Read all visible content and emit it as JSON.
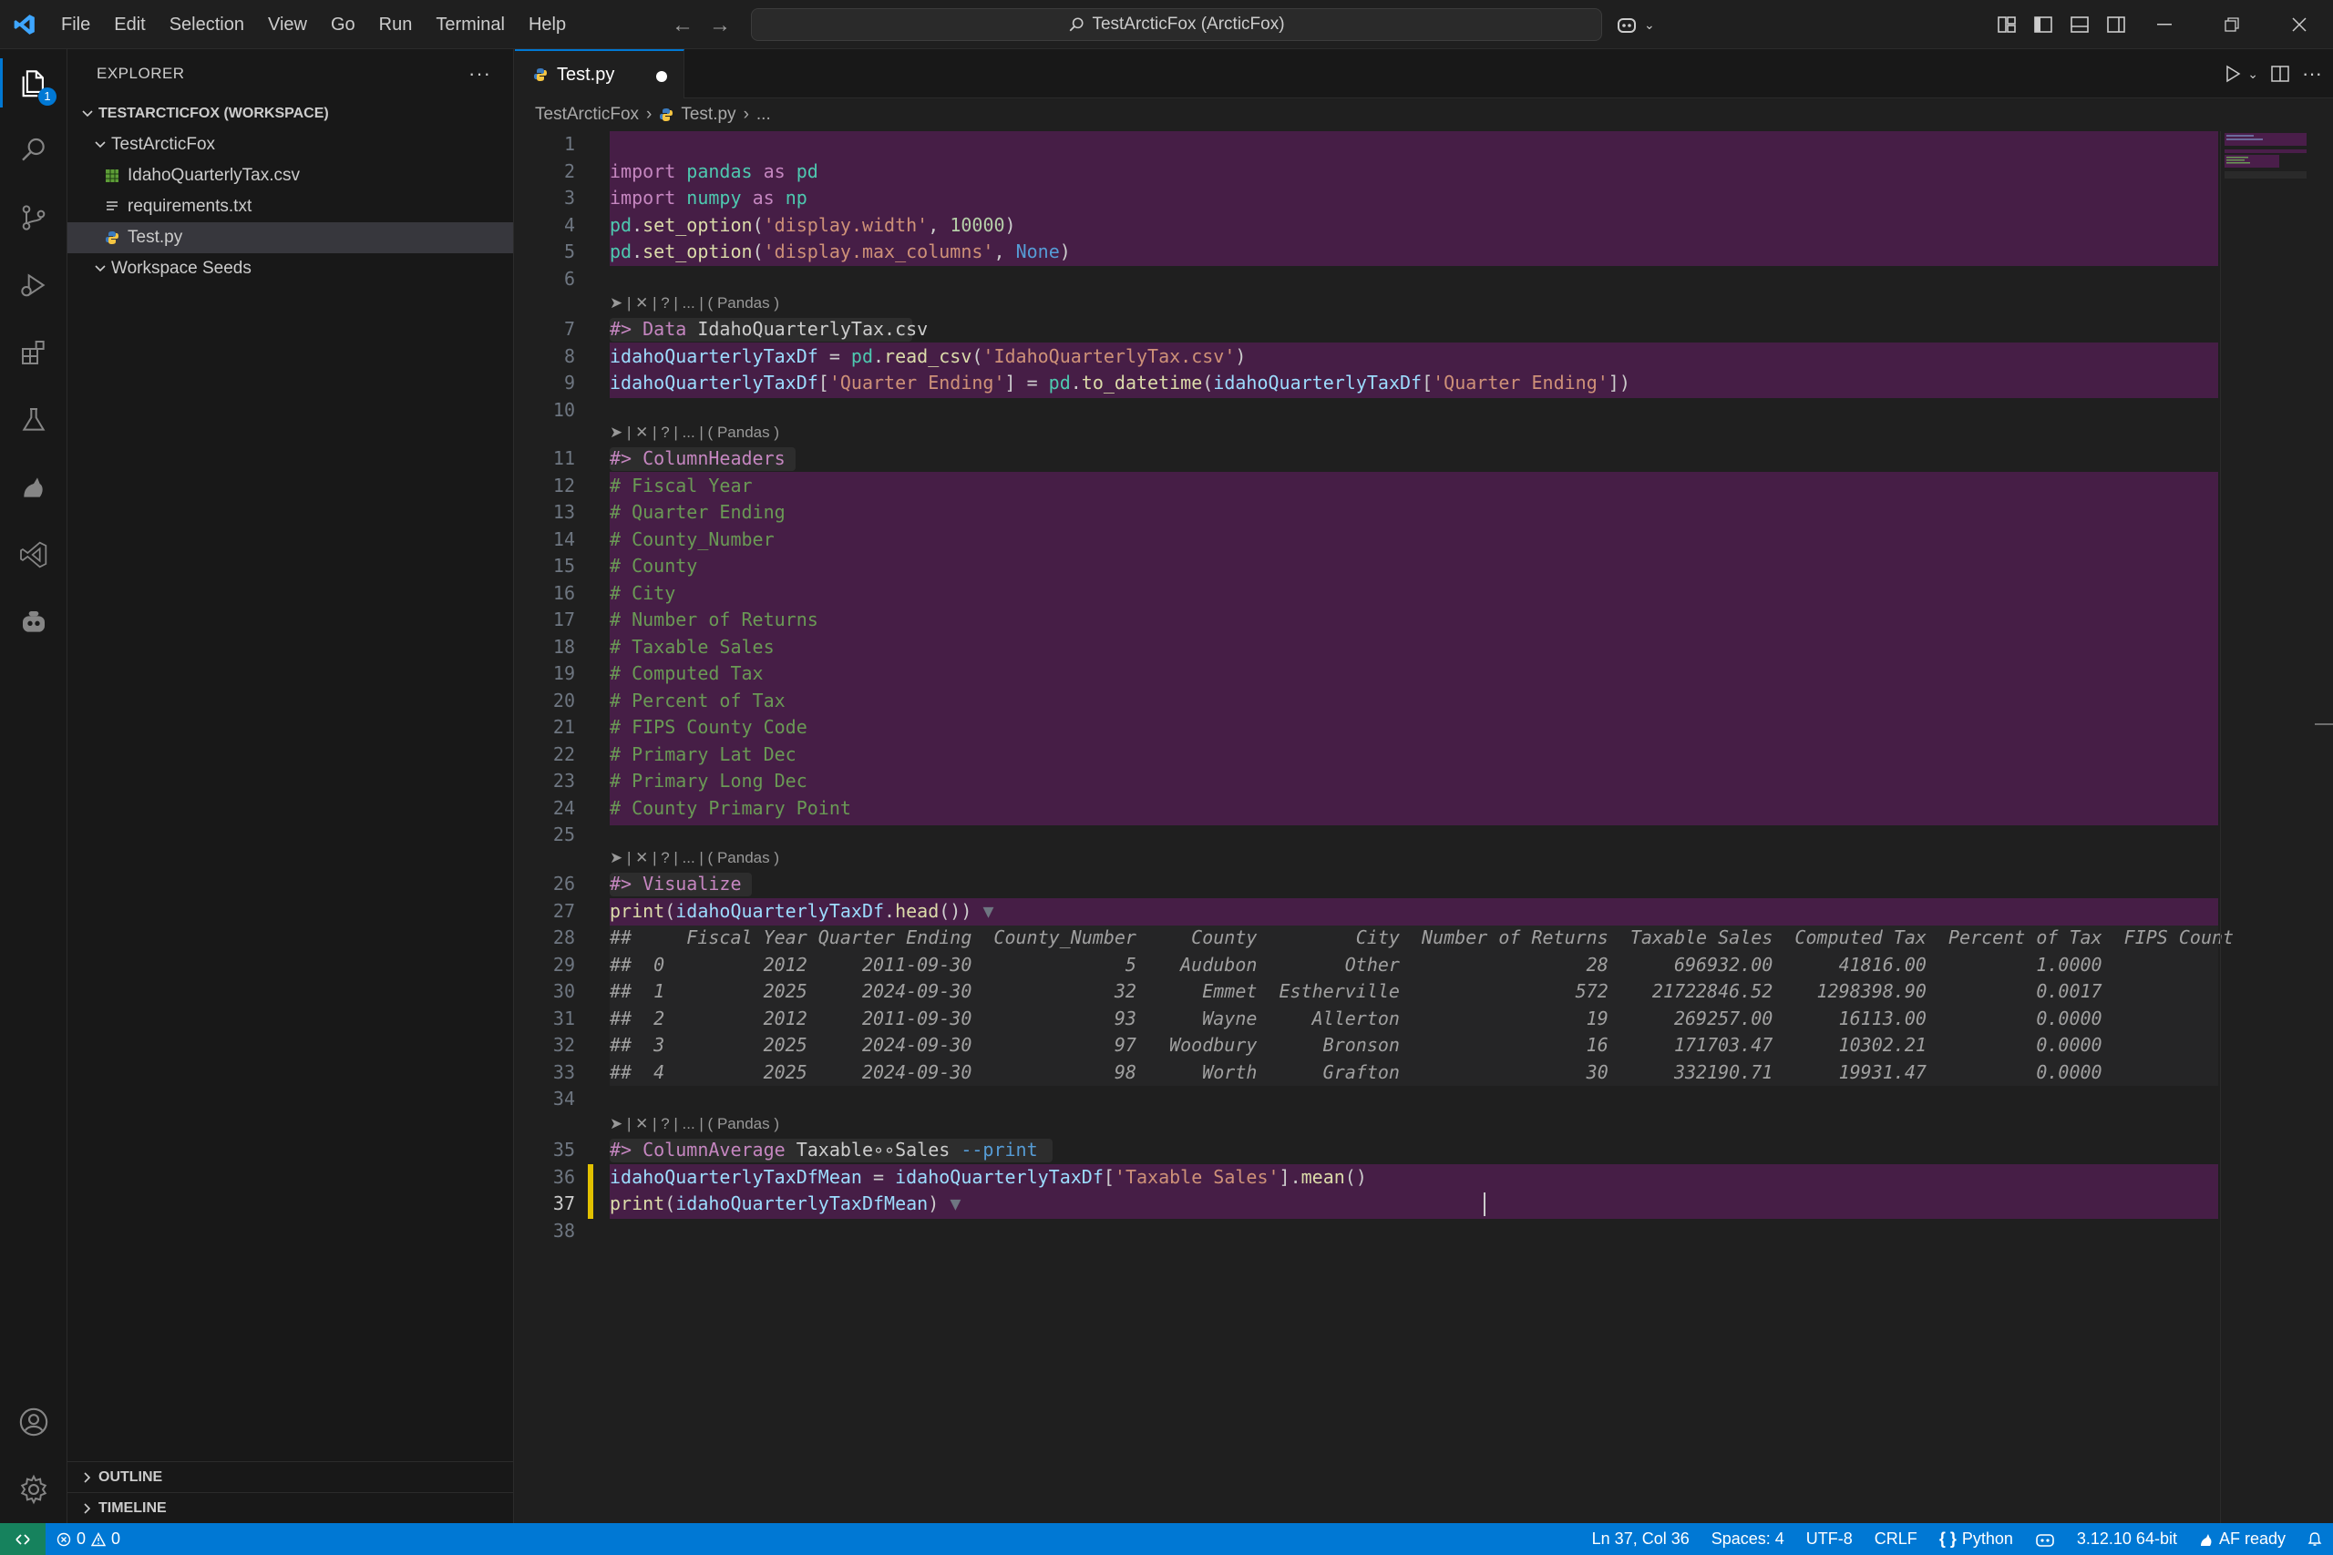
{
  "titlebar": {
    "menu": [
      "File",
      "Edit",
      "Selection",
      "View",
      "Go",
      "Run",
      "Terminal",
      "Help"
    ],
    "search_text": "TestArcticFox (ArcticFox)"
  },
  "activity": {
    "explorer_badge": "1"
  },
  "sidebar": {
    "title": "EXPLORER",
    "workspace": "TESTARCTICFOX (WORKSPACE)",
    "folder": "TestArcticFox",
    "files": [
      "IdahoQuarterlyTax.csv",
      "requirements.txt",
      "Test.py"
    ],
    "folder2": "Workspace Seeds",
    "outline": "OUTLINE",
    "timeline": "TIMELINE"
  },
  "tab": {
    "label": "Test.py"
  },
  "breadcrumb": {
    "root": "TestArcticFox",
    "file": "Test.py",
    "more": "..."
  },
  "editor": {
    "line_numbers": [
      "1",
      "2",
      "3",
      "4",
      "5",
      "6",
      "7",
      "8",
      "9",
      "10",
      "11",
      "12",
      "13",
      "14",
      "15",
      "16",
      "17",
      "18",
      "19",
      "20",
      "21",
      "22",
      "23",
      "24",
      "25",
      "26",
      "27",
      "28",
      "29",
      "30",
      "31",
      "32",
      "33",
      "34",
      "35",
      "36",
      "37",
      "38"
    ],
    "lens": "➤ | ✕ | ? | ... | ( Pandas )",
    "comments": [
      "# Fiscal Year",
      "# Quarter Ending",
      "# County_Number",
      "# County",
      "# City",
      "# Number of Returns",
      "# Taxable Sales",
      "# Computed Tax",
      "# Percent of Tax",
      "# FIPS County Code",
      "# Primary Lat Dec",
      "# Primary Long Dec",
      "# County Primary Point"
    ],
    "output_header": "##     Fiscal Year Quarter Ending  County_Number     County         City  Number of Returns  Taxable Sales  Computed Tax  Percent of Tax  FIPS Count",
    "output_rows": [
      "##  0         2012     2011-09-30              5    Audubon        Other                 28      696932.00      41816.00          1.0000",
      "##  1         2025     2024-09-30             32      Emmet  Estherville                572    21722846.52    1298398.90          0.0017",
      "##  2         2012     2011-09-30             93      Wayne     Allerton                 19      269257.00      16113.00          0.0000",
      "##  3         2025     2024-09-30             97   Woodbury      Bronson                 16      171703.47      10302.21          0.0000",
      "##  4         2025     2024-09-30             98      Worth      Grafton                 30      332190.71      19931.47          0.0000"
    ]
  },
  "statusbar": {
    "errors": "0",
    "warnings": "0",
    "position": "Ln 37, Col 36",
    "spaces": "Spaces: 4",
    "encoding": "UTF-8",
    "eol": "CRLF",
    "language": "Python",
    "interpreter": "3.12.10 64-bit",
    "af": "AF ready"
  },
  "colors": {
    "accent": "#0078d4",
    "cell_highlight": "#4a1e4a",
    "status_remote": "#16825d"
  }
}
